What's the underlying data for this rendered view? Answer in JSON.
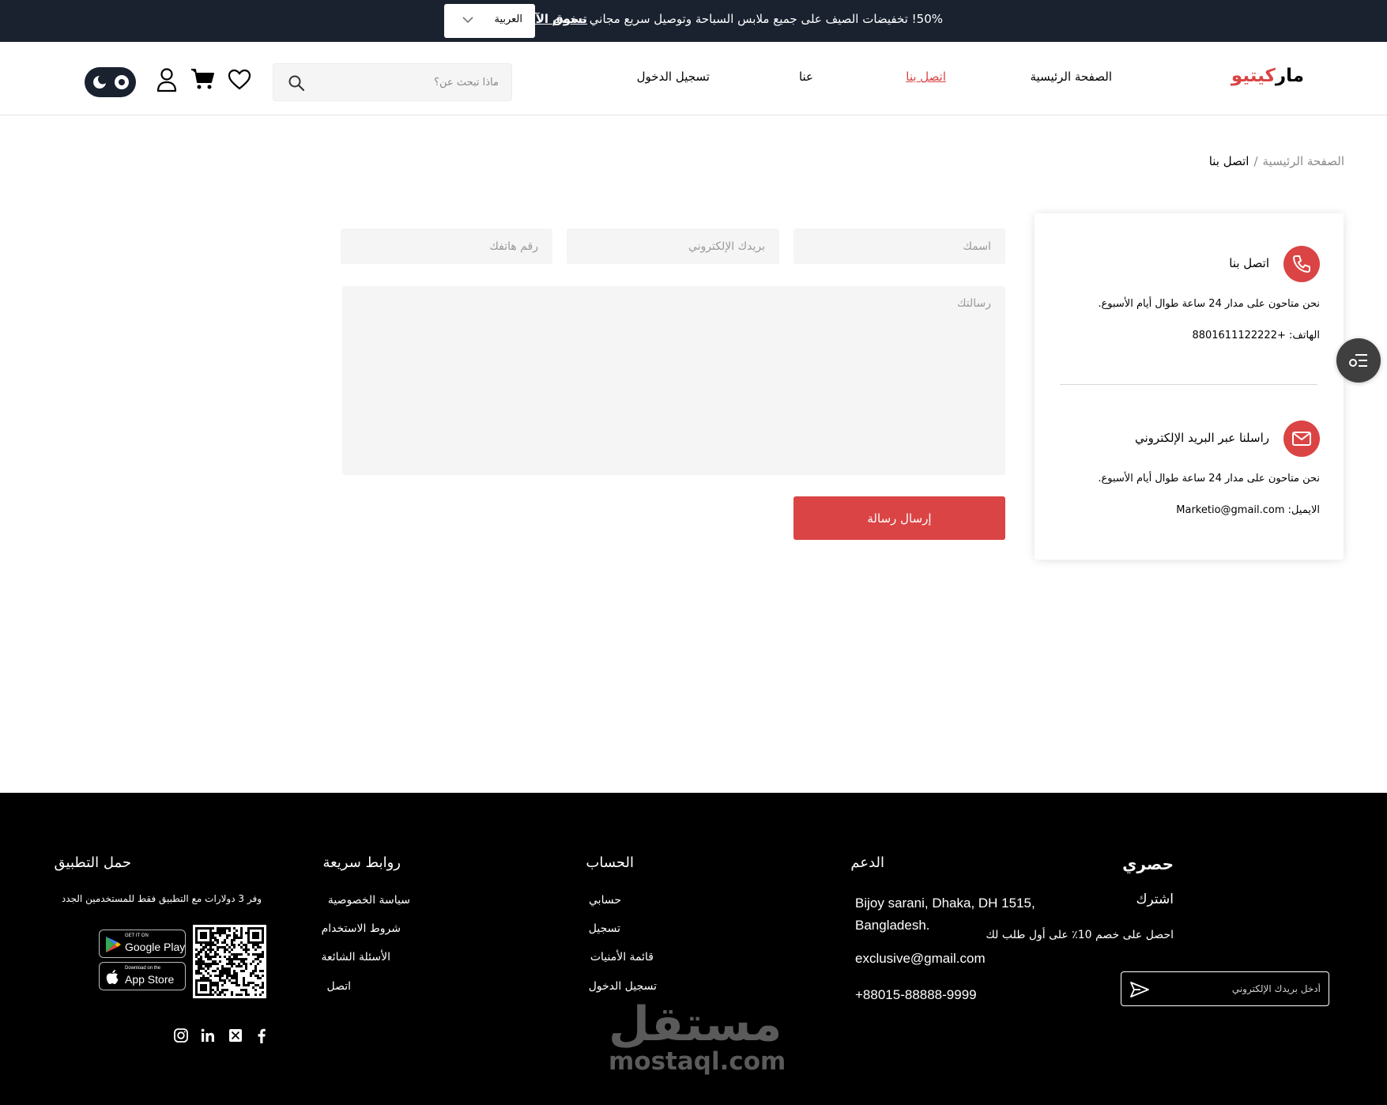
{
  "topbar": {
    "promo": "50%! تخفيضات الصيف على جميع ملابس السباحة وتوصيل سريع مجاني - خصم",
    "shop_now": "تسوق الآن",
    "language": "العربية"
  },
  "header": {
    "logo_main": "مار",
    "logo_accent": "كيتيو",
    "nav": {
      "home": "الصفحة الرئيسية",
      "contact": "اتصل بنا",
      "about": "عنا",
      "signup": "تسجيل الدخول"
    },
    "search_placeholder": "ماذا تبحث عن؟",
    "icons": [
      "search-icon",
      "wishlist-icon",
      "cart-icon",
      "user-icon",
      "theme-toggle"
    ]
  },
  "breadcrumb": {
    "home": "الصفحة الرئيسية",
    "separator": "/",
    "current": "اتصل بنا"
  },
  "contact_card": {
    "call": {
      "title": "اتصل بنا",
      "availability": "نحن متاحون على مدار 24 ساعة طوال أيام الأسبوع.",
      "phone": "الهاتف: +8801611122222"
    },
    "mail": {
      "title": "راسلنا عبر البريد الإلكتروني",
      "availability": "نحن متاحون على مدار 24 ساعة طوال أيام الأسبوع.",
      "email": "الايميل: Marketio@gmail.com"
    }
  },
  "form": {
    "name_placeholder": "اسمك",
    "email_placeholder": "بريدك الإلكتروني",
    "phone_placeholder": "رقم هاتفك",
    "message_placeholder": "رسالتك",
    "submit": "إرسال رسالة"
  },
  "footer": {
    "exclusive": {
      "title": "حصري",
      "subscribe": "اشترك",
      "offer": "احصل على خصم 10٪ على أول طلب لك",
      "email_placeholder": "أدخل بريدك الإلكتروني"
    },
    "support": {
      "title": "الدعم",
      "address": "Bijoy sarani, Dhaka, DH 1515, Bangladesh.",
      "email": "exclusive@gmail.com",
      "phone": "+88015-88888-9999"
    },
    "account": {
      "title": "الحساب",
      "links": [
        "حسابي",
        "تسجيل",
        "قائمة الأمنيات",
        "تسجيل الدخول"
      ]
    },
    "quick_links": {
      "title": "روابط سريعة",
      "links": [
        "سياسة الخصوصية",
        "شروط الاستخدام",
        "الأسئلة الشائعة",
        "اتصل"
      ]
    },
    "app": {
      "title": "حمل التطبيق",
      "offer": "وفر 3 دولارات مع التطبيق فقط للمستخدمين الجدد",
      "google_small": "GET IT ON",
      "google_big": "Google Play",
      "apple_small": "Download on the",
      "apple_big": "App Store"
    },
    "social_icons": [
      "instagram-icon",
      "linkedin-icon",
      "x-icon",
      "facebook-icon"
    ]
  },
  "watermark": {
    "arabic": "مستقل",
    "latin": "mostaql.com"
  },
  "colors": {
    "accent": "#db4444",
    "topbar": "#1a2230",
    "footer": "#000000"
  }
}
